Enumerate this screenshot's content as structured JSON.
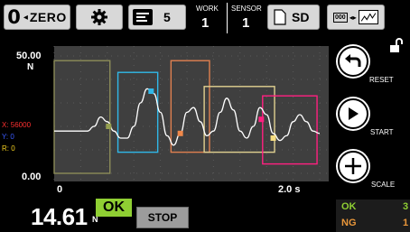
{
  "toolbar": {
    "zero_big": "0",
    "zero_arrow": "◂",
    "zero_label": "ZERO",
    "bank_number": "5",
    "work_label": "WORK",
    "work_value": "1",
    "sensor_label": "SENSOR",
    "sensor_value": "1",
    "sd_label": "SD",
    "graph_number": "000"
  },
  "right_panel": {
    "reset_label": "RESET",
    "start_label": "START",
    "scale_label": "SCALE"
  },
  "legend": {
    "x_line": "X: 56000",
    "y_line": "Y: 0",
    "r_line": "R: 0"
  },
  "status": {
    "value": "14.61",
    "unit": "N",
    "judgement": "OK",
    "stop_label": "STOP",
    "ok_count_label": "OK",
    "ok_count_value": "3",
    "ng_count_label": "NG",
    "ng_count_value": "1"
  },
  "colors": {
    "plot_bg": "#3f3f3f",
    "ok_green": "#8fcf33",
    "ng_orange": "#e8963a",
    "legend_x": "#ff3030",
    "legend_y": "#3a5bff",
    "legend_r": "#f5d020"
  },
  "chart_data": {
    "type": "line",
    "title": "",
    "xlabel": "",
    "ylabel": "",
    "y_unit": "N",
    "xlim": [
      0,
      2.0
    ],
    "ylim": [
      0,
      50
    ],
    "x_tick_labels": [
      "0",
      "2.0 s"
    ],
    "y_tick_labels": [
      "50.00",
      "0.00"
    ],
    "grid": true,
    "series": [
      {
        "color": "#ffffff",
        "x": [
          0.0,
          0.05,
          0.1,
          0.15,
          0.2,
          0.25,
          0.3,
          0.35,
          0.4,
          0.45,
          0.5,
          0.55,
          0.6,
          0.65,
          0.7,
          0.75,
          0.8,
          0.85,
          0.9,
          0.95,
          1.0,
          1.05,
          1.1,
          1.15,
          1.2,
          1.25,
          1.3,
          1.35,
          1.4,
          1.45,
          1.5,
          1.55,
          1.6,
          1.65,
          1.7,
          1.75,
          1.8,
          1.85,
          1.9,
          1.95,
          2.0
        ],
        "y": [
          18,
          18,
          18,
          18,
          18,
          18,
          20,
          24,
          22,
          18,
          15,
          15,
          20,
          30,
          36,
          34,
          26,
          16,
          12,
          17,
          26,
          28,
          22,
          16,
          18,
          26,
          32,
          27,
          18,
          15,
          20,
          28,
          25,
          17,
          14,
          16,
          22,
          25,
          22,
          18,
          17
        ]
      }
    ],
    "markers": [
      {
        "x": 0.41,
        "y": 20,
        "color": "#96a050"
      },
      {
        "x": 0.73,
        "y": 35,
        "color": "#30b8e8"
      },
      {
        "x": 0.95,
        "y": 17,
        "color": "#f0884a"
      },
      {
        "x": 1.56,
        "y": 23,
        "color": "#ff2080"
      },
      {
        "x": 1.65,
        "y": 15,
        "color": "#f5dc80"
      }
    ],
    "judgement_windows": [
      {
        "x_min": 0.0,
        "x_max": 0.42,
        "y_min": 0,
        "y_max": 48,
        "color": "#8c8c58"
      },
      {
        "x_min": 0.48,
        "x_max": 0.78,
        "y_min": 9,
        "y_max": 43,
        "color": "#30b8e8"
      },
      {
        "x_min": 0.88,
        "x_max": 1.17,
        "y_min": 9,
        "y_max": 48,
        "color": "#e08050"
      },
      {
        "x_min": 1.13,
        "x_max": 1.66,
        "y_min": 9,
        "y_max": 37,
        "color": "#e0d090"
      },
      {
        "x_min": 1.57,
        "x_max": 1.98,
        "y_min": 4,
        "y_max": 33,
        "color": "#ff2080"
      }
    ]
  }
}
